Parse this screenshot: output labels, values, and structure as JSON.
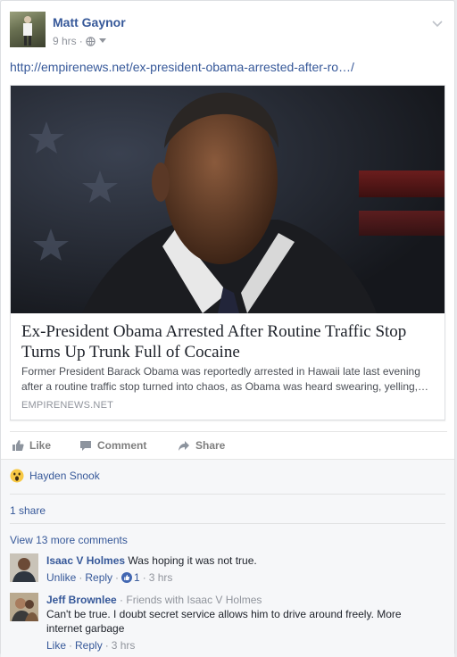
{
  "post": {
    "author": "Matt Gaynor",
    "time": "9 hrs",
    "link_url": "http://empirenews.net/ex-president-obama-arrested-after-ro…/",
    "article": {
      "title": "Ex-President Obama Arrested After Routine Traffic Stop Turns Up Trunk Full of Cocaine",
      "description": "Former President Barack Obama was reportedly arrested in Hawaii late last evening after a routine traffic stop turned into chaos, as Obama was heard swearing, yelling,…",
      "source": "EMPIRENEWS.NET"
    }
  },
  "actions": {
    "like": "Like",
    "comment": "Comment",
    "share": "Share"
  },
  "reactions": {
    "name": "Hayden Snook",
    "emoji_icon": "wow-icon"
  },
  "shares": "1 share",
  "view_more": "View 13 more comments",
  "comments": [
    {
      "author": "Isaac V Holmes",
      "text": "Was hoping it was not true.",
      "actions": {
        "primary": "Unlike",
        "reply": "Reply",
        "likes": "1",
        "time": "3 hrs"
      }
    },
    {
      "author": "Jeff Brownlee",
      "subtitle": "Friends with Isaac V Holmes",
      "text": "Can't be true. I doubt secret service allows him to drive around freely. More internet garbage",
      "actions": {
        "primary": "Like",
        "reply": "Reply",
        "time": "3 hrs"
      }
    }
  ],
  "colors": {
    "link": "#365899",
    "muted": "#90949c",
    "accent": "#4267b2"
  }
}
